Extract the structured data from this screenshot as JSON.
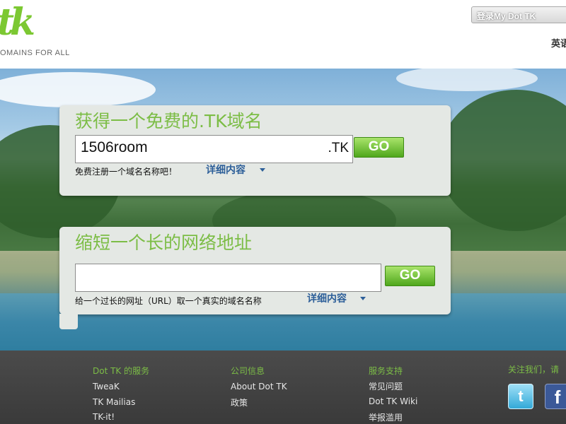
{
  "header": {
    "logo_mark": "tk",
    "logo_tagline": "OMAINS FOR ALL",
    "login_label": "登录My Dot TK",
    "language_label": "英语"
  },
  "register_panel": {
    "title": "获得一个免费的.TK域名",
    "input_value": "1506room",
    "domain_suffix": ".TK",
    "go_label": "GO",
    "hint": "免费注册一个域名名称吧！",
    "details_label": "详细内容"
  },
  "shorten_panel": {
    "title": "缩短一个长的网络地址",
    "input_value": "",
    "go_label": "GO",
    "hint": "给一个过长的网址（URL）取一个真实的域名名称",
    "details_label": "详细内容"
  },
  "footer": {
    "columns": [
      {
        "heading": "Dot TK 的服务",
        "items": [
          "TweaK",
          "TK Mailias",
          "TK-it!"
        ]
      },
      {
        "heading": "公司信息",
        "items": [
          "About Dot TK",
          "政策"
        ]
      },
      {
        "heading": "服务支持",
        "items": [
          "常见问题",
          "Dot TK Wiki",
          "举报滥用"
        ]
      }
    ],
    "follow_label": "关注我们，请",
    "social": [
      "twitter-icon",
      "facebook-icon"
    ]
  },
  "colors": {
    "brand_green": "#7cbd46",
    "link_blue": "#2d5f99",
    "footer_bg": "#444444"
  }
}
